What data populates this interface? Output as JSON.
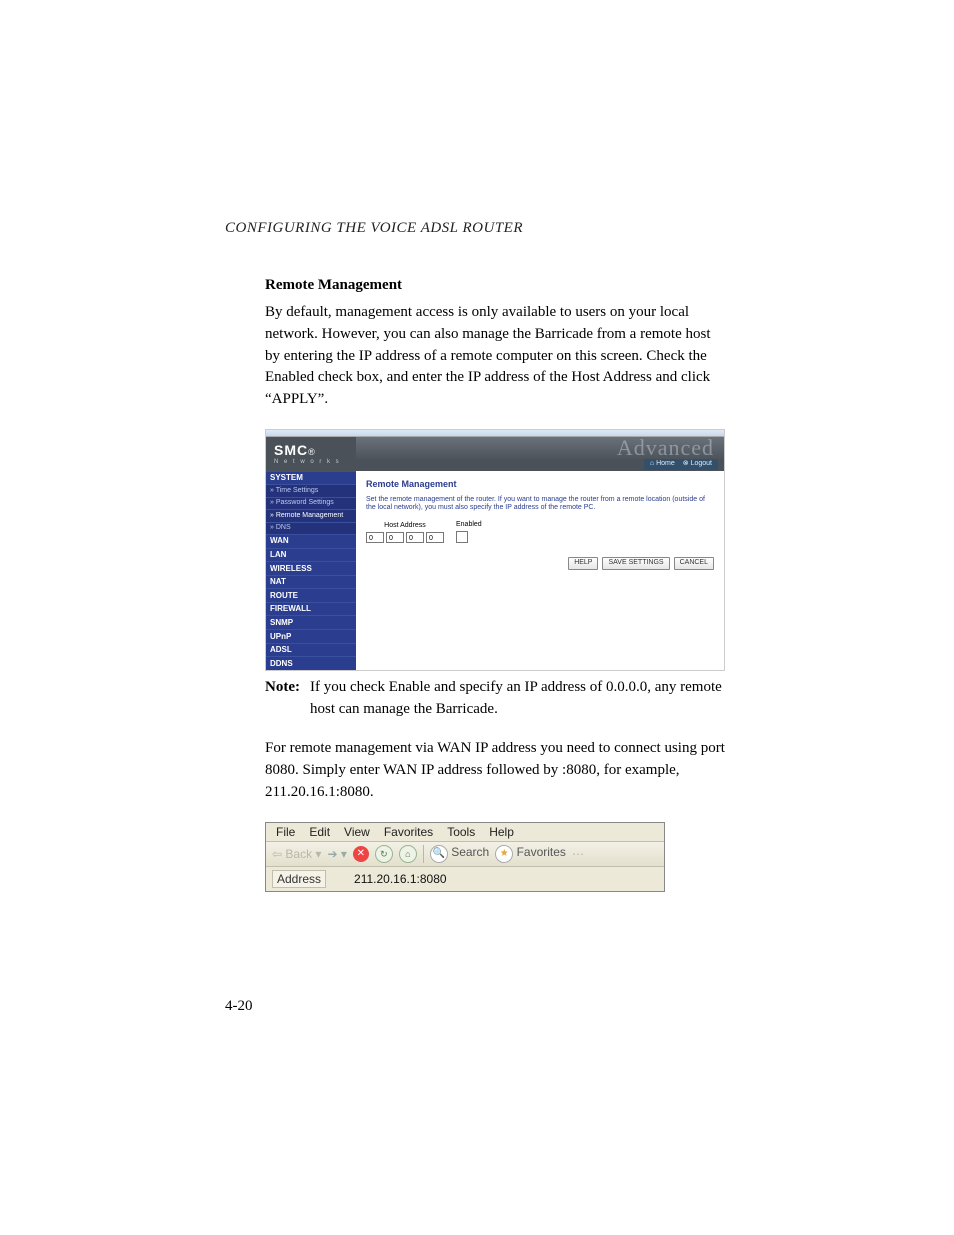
{
  "runningHead": "CONFIGURING THE VOICE ADSL ROUTER",
  "heading": "Remote Management",
  "para1": "By default, management access is only available to users on your local network. However, you can also manage the Barricade from a remote host by entering the IP address of a remote computer on this screen. Check the Enabled check box, and enter the IP address of the Host Address and click “APPLY”.",
  "noteLabel": "Note:",
  "noteText": "If you check Enable and specify an IP address of 0.0.0.0, any remote host can manage the Barricade.",
  "para2": "For remote management via WAN IP address you need to connect using port 8080. Simply enter WAN IP address followed by :8080, for example, 211.20.16.1:8080.",
  "pageNumber": "4-20",
  "router": {
    "logoBrand": "SMC",
    "logoReg": "®",
    "logoSub": "N e t w o r k s",
    "advanced": "Advanced",
    "homeLink": "Home",
    "logoutLink": "Logout",
    "nav": [
      {
        "label": "SYSTEM",
        "type": "top"
      },
      {
        "label": "» Time Settings",
        "type": "child"
      },
      {
        "label": "» Password Settings",
        "type": "child"
      },
      {
        "label": "» Remote Management",
        "type": "child active"
      },
      {
        "label": "» DNS",
        "type": "child"
      },
      {
        "label": "WAN",
        "type": "top"
      },
      {
        "label": "LAN",
        "type": "top"
      },
      {
        "label": "WIRELESS",
        "type": "top"
      },
      {
        "label": "NAT",
        "type": "top"
      },
      {
        "label": "ROUTE",
        "type": "top"
      },
      {
        "label": "FIREWALL",
        "type": "top"
      },
      {
        "label": "SNMP",
        "type": "top"
      },
      {
        "label": "UPnP",
        "type": "top"
      },
      {
        "label": "ADSL",
        "type": "top"
      },
      {
        "label": "DDNS",
        "type": "top"
      }
    ],
    "paneTitle": "Remote Management",
    "paneDesc": "Set the remote management of the router. If you want to manage the router from a remote location (outside of the local network), you must also specify the IP address of the remote PC.",
    "hostAddressLabel": "Host Address",
    "enabledLabel": "Enabled",
    "octets": [
      "0",
      "0",
      "0",
      "0"
    ],
    "btnHelp": "HELP",
    "btnSave": "SAVE SETTINGS",
    "btnCancel": "CANCEL"
  },
  "ie": {
    "menu": [
      "File",
      "Edit",
      "View",
      "Favorites",
      "Tools",
      "Help"
    ],
    "back": "Back",
    "search": "Search",
    "favorites": "Favorites",
    "addressLabel": "Address",
    "url": "211.20.16.1:8080"
  }
}
